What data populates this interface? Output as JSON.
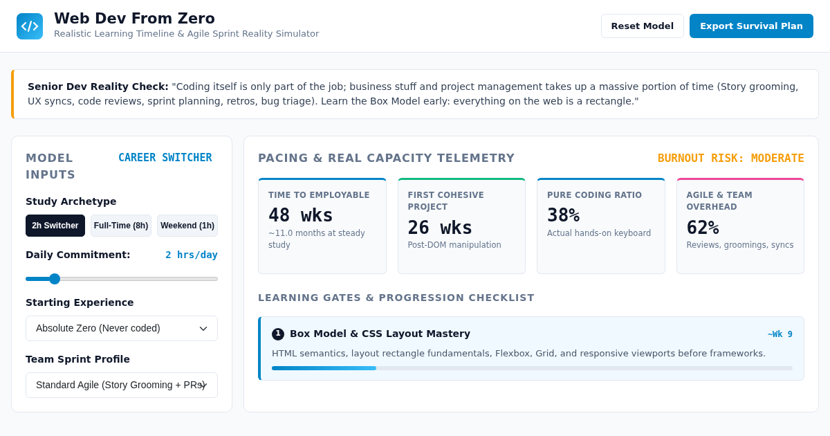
{
  "header": {
    "title": "Web Dev From Zero",
    "subtitle": "Realistic Learning Timeline & Agile Sprint Reality Simulator",
    "buttons": [
      {
        "label": "Reset Model",
        "kind": "outline"
      },
      {
        "label": "Export Survival Plan",
        "kind": "primary"
      }
    ]
  },
  "callout": {
    "text": "**Senior Dev Reality Check:** \"Coding itself is only part of the job; business stuff and project management takes up a massive portion of time (Story grooming, UX syncs, code reviews, sprint planning, retros, bug triage). Learn the Box Model early: everything on the web is a rectangle.\""
  },
  "inputs": {
    "title": "MODEL INPUTS",
    "profile": "CAREER SWITCHER",
    "archetype_label": "Study Archetype",
    "archetypes": [
      {
        "label": "2h Switcher",
        "selected": true
      },
      {
        "label": "Full-Time (8h)",
        "selected": false
      },
      {
        "label": "Weekend (1h)",
        "selected": false
      }
    ],
    "commitment_label": "Daily Commitment:",
    "commitment_reading": "2 hrs/day",
    "commitment_slider": {
      "level": 0.13
    },
    "experience_label": "Starting Experience",
    "experience_value": "Absolute Zero (Never coded)",
    "sprint_label": "Team Sprint Profile",
    "sprint_value": "Standard Agile (Story Grooming + PRs)"
  },
  "telemetry": {
    "title": "PACING & REAL CAPACITY TELEMETRY",
    "risk": "BURNOUT RISK: MODERATE",
    "metrics": [
      {
        "label": "TIME TO EMPLOYABLE",
        "value": "48 wks",
        "note": "~11.0 months at steady study",
        "color": "#0284c7"
      },
      {
        "label": "FIRST COHESIVE PROJECT",
        "value": "26 wks",
        "note": "Post-DOM manipulation",
        "color": "#10b981"
      },
      {
        "label": "PURE CODING RATIO",
        "value": "38%",
        "note": "Actual hands-on keyboard",
        "color": "#0284c7"
      },
      {
        "label": "AGILE & TEAM OVERHEAD",
        "value": "62%",
        "note": "Reviews, groomings, syncs",
        "color": "#ec4899"
      }
    ],
    "gates_title": "LEARNING GATES & PROGRESSION CHECKLIST",
    "gates": [
      {
        "number": "1",
        "title": "Box Model & CSS Layout Mastery",
        "week": "~Wk 9",
        "description": "HTML semantics, layout rectangle fundamentals, Flexbox, Grid, and responsive viewports before frameworks.",
        "level": 0.2
      }
    ]
  }
}
